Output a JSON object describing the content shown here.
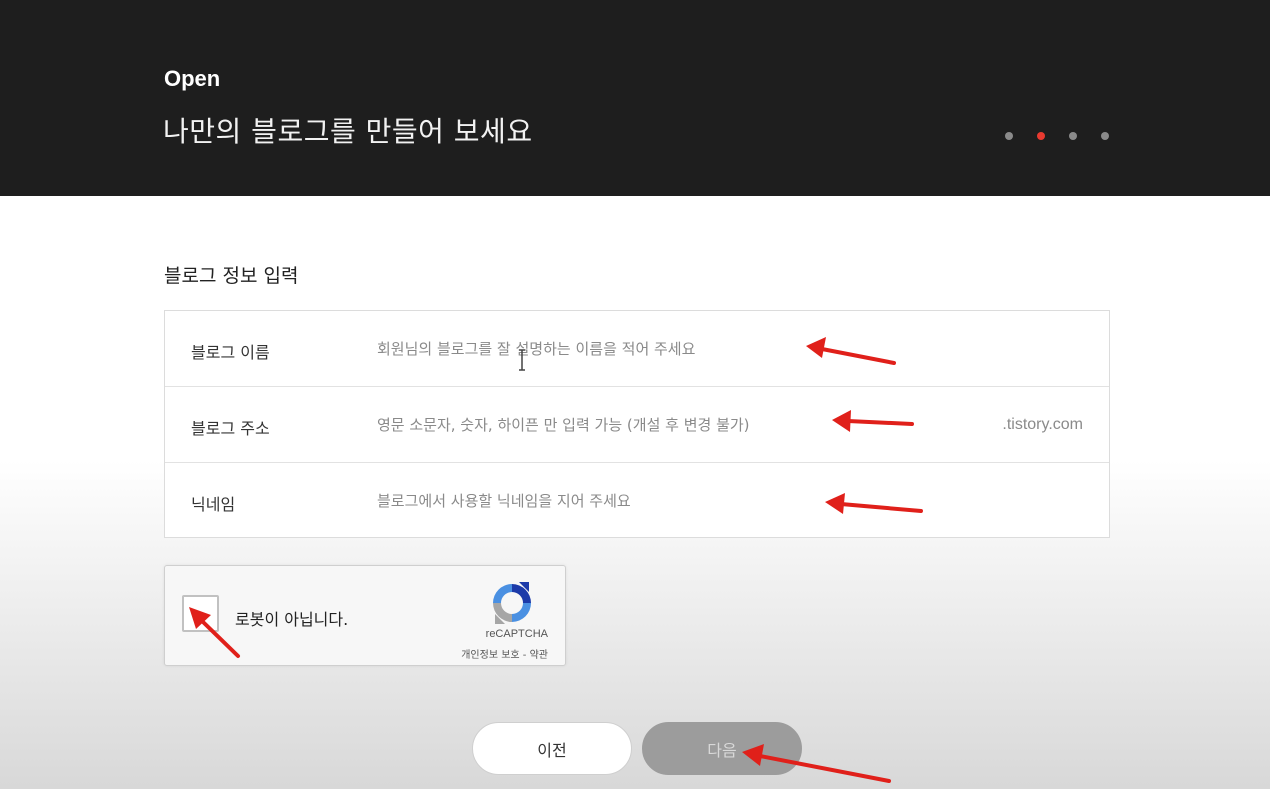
{
  "header": {
    "brand": "Open",
    "title": "나만의 블로그를 만들어 보세요",
    "steps": {
      "total": 4,
      "current": 2
    }
  },
  "section": {
    "title": "블로그 정보 입력"
  },
  "form": {
    "rows": [
      {
        "label": "블로그 이름",
        "value": "",
        "placeholder": "회원님의 블로그를 잘 설명하는 이름을 적어 주세요"
      },
      {
        "label": "블로그 주소",
        "value": "",
        "placeholder": "영문 소문자, 숫자, 하이픈 만 입력 가능 (개설 후 변경 불가)",
        "suffix": ".tistory.com"
      },
      {
        "label": "닉네임",
        "value": "",
        "placeholder": "블로그에서 사용할 닉네임을 지어 주세요"
      }
    ]
  },
  "recaptcha": {
    "label": "로봇이 아닙니다.",
    "brand": "reCAPTCHA",
    "privacy": "개인정보 보호",
    "separator": " - ",
    "terms": "약관",
    "checked": false
  },
  "buttons": {
    "prev": "이전",
    "next": "다음"
  },
  "colors": {
    "header_bg": "#1e1e1e",
    "active_dot": "#e83a30",
    "annotation_arrow": "#e0201a",
    "next_button_bg": "#9c9c9c"
  }
}
